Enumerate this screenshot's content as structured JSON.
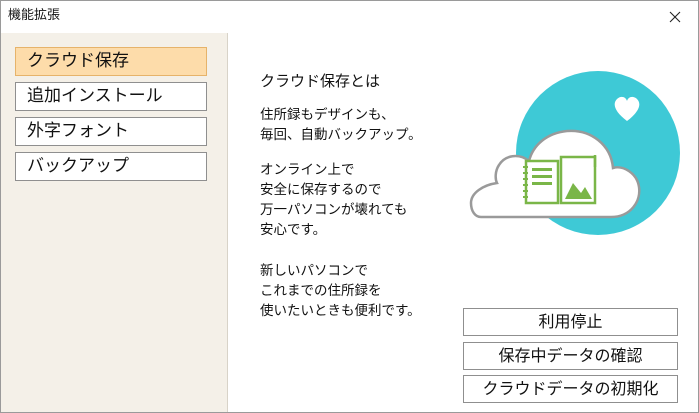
{
  "window": {
    "title": "機能拡張"
  },
  "sidebar": {
    "items": [
      {
        "label": "クラウド保存",
        "selected": true
      },
      {
        "label": "追加インストール",
        "selected": false
      },
      {
        "label": "外字フォント",
        "selected": false
      },
      {
        "label": "バックアップ",
        "selected": false
      }
    ]
  },
  "main": {
    "heading": "クラウド保存とは",
    "paragraphs": [
      [
        "住所録もデザインも、",
        "毎回、自動バックアップ。"
      ],
      [
        "オンライン上で",
        "安全に保存するので",
        "万一パソコンが壊れても",
        "安心です。"
      ],
      [
        "新しいパソコンで",
        "これまでの住所録を",
        "使いたいときも便利です。"
      ]
    ],
    "buttons": {
      "stop": "利用停止",
      "check_data": "保存中データの確認",
      "reset_data": "クラウドデータの初期化"
    }
  },
  "icons": {
    "close": "close-icon",
    "illustration": "cloud-storage-illustration",
    "heart": "heart-icon",
    "notebook": "notebook-icon",
    "photo_album": "photo-album-icon"
  },
  "colors": {
    "selected_item": "#fddcaa",
    "sidebar_bg": "#f4f0e8",
    "accent_cyan": "#3ec9d6",
    "illustration_green": "#7ab648"
  }
}
